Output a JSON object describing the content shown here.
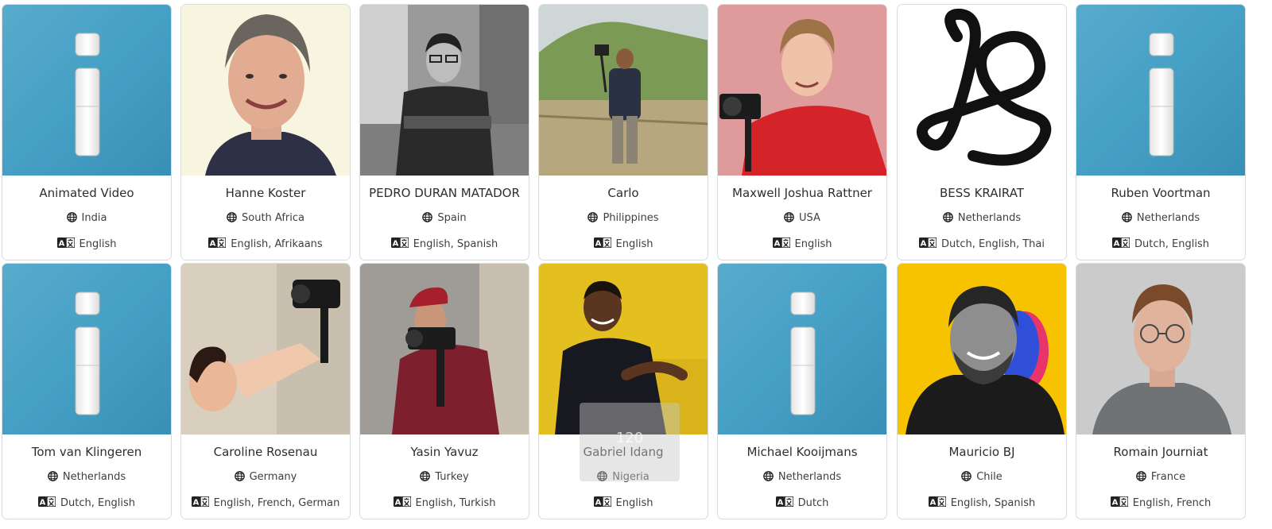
{
  "cards": [
    {
      "name": "Animated Video",
      "country": "India",
      "languages": "English",
      "photo": "info-icon-image"
    },
    {
      "name": "Hanne Koster",
      "country": "South Africa",
      "languages": "English, Afrikaans",
      "photo": "portrait-woman-smiling"
    },
    {
      "name": "PEDRO DURAN MATADOR",
      "country": "Spain",
      "languages": "English, Spanish",
      "photo": "portrait-man-bw"
    },
    {
      "name": "Carlo",
      "country": "Philippines",
      "languages": "English",
      "photo": "man-with-camera-field"
    },
    {
      "name": "Maxwell Joshua Rattner",
      "country": "USA",
      "languages": "English",
      "photo": "man-with-gimbal-red"
    },
    {
      "name": "BESS KRAIRAT",
      "country": "Netherlands",
      "languages": "Dutch, English, Thai",
      "photo": "script-b-logo"
    },
    {
      "name": "Ruben Voortman",
      "country": "Netherlands",
      "languages": "Dutch, English",
      "photo": "info-icon-image"
    },
    {
      "name": "Tom van Klingeren",
      "country": "Netherlands",
      "languages": "Dutch, English",
      "photo": "info-icon-image"
    },
    {
      "name": "Caroline Rosenau",
      "country": "Germany",
      "languages": "English, French, German",
      "photo": "woman-with-film-camera"
    },
    {
      "name": "Yasin Yavuz",
      "country": "Turkey",
      "languages": "English, Turkish",
      "photo": "man-with-gimbal-stone"
    },
    {
      "name": "Gabriel Idang",
      "country": "Nigeria",
      "languages": "English",
      "photo": "man-yellow-background",
      "overlay_text": "120"
    },
    {
      "name": "Michael Kooijmans",
      "country": "Netherlands",
      "languages": "Dutch",
      "photo": "info-icon-image"
    },
    {
      "name": "Mauricio BJ",
      "country": "Chile",
      "languages": "English, Spanish",
      "photo": "man-yellow-pop-art"
    },
    {
      "name": "Romain Journiat",
      "country": "France",
      "languages": "English, French",
      "photo": "man-glasses-grey"
    }
  ]
}
